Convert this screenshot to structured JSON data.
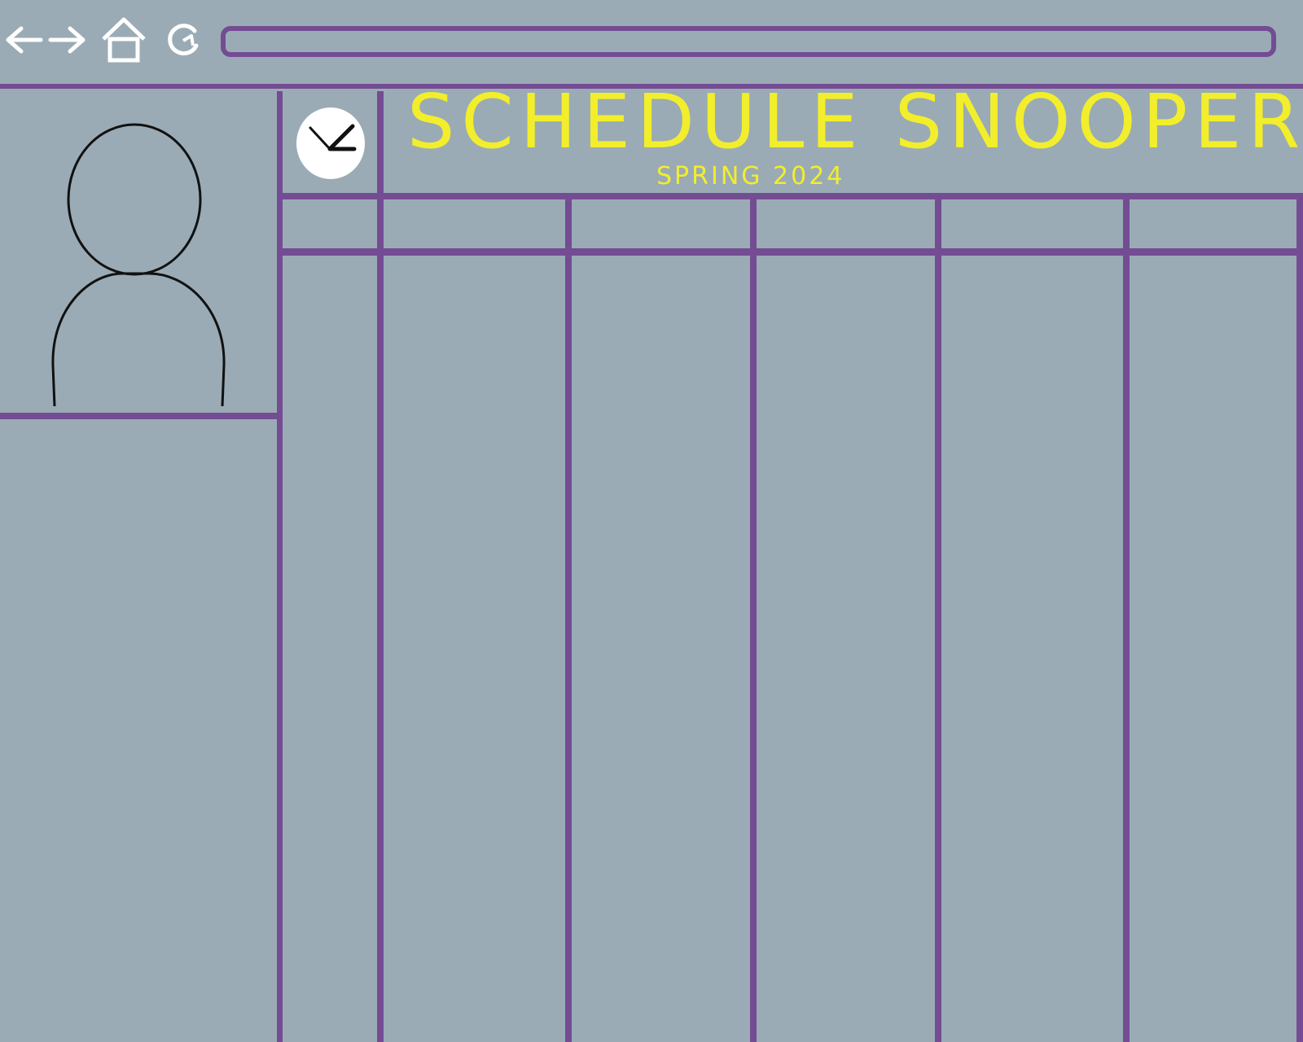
{
  "browser": {
    "back_icon": "arrow-left-icon",
    "forward_icon": "arrow-right-icon",
    "home_icon": "home-icon",
    "refresh_icon": "refresh-icon",
    "address_value": "",
    "address_placeholder": ""
  },
  "header": {
    "title": "SCHEDULE SNOOPER",
    "term": "SPRING 2024",
    "clock_icon": "clock-icon"
  },
  "profile": {
    "avatar_icon": "user-avatar-icon"
  },
  "colors": {
    "background": "#9aabb5",
    "accent": "#744c93",
    "title": "#f2ee2c",
    "icon": "#ffffff"
  },
  "calendar": {
    "day_columns": 5,
    "day_headers": [
      "",
      "",
      "",
      "",
      ""
    ],
    "time_header": ""
  }
}
